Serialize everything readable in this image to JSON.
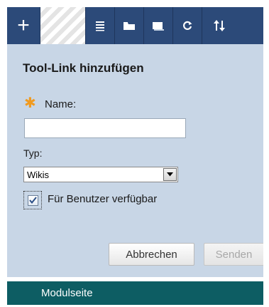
{
  "toolbar": {
    "add_label": "+",
    "icons": [
      "add-icon",
      "list-icon",
      "folder-icon",
      "window-icon",
      "refresh-icon",
      "sort-icon"
    ]
  },
  "panel": {
    "title": "Tool-Link hinzufügen",
    "required_marker": "✱",
    "name_label": "Name:",
    "name_value": "",
    "typ_label": "Typ:",
    "typ_selected": "Wikis",
    "checkbox_label": "Für Benutzer verfügbar",
    "checkbox_checked": true,
    "cancel_label": "Abbrechen",
    "submit_label": "Senden"
  },
  "module_bar": {
    "label": "Modulseite"
  },
  "colors": {
    "toolbar_bg": "#2c4a79",
    "panel_bg": "#c8d6e6",
    "required_star": "#f09a1f",
    "module_bar_bg": "#0d5d63"
  }
}
